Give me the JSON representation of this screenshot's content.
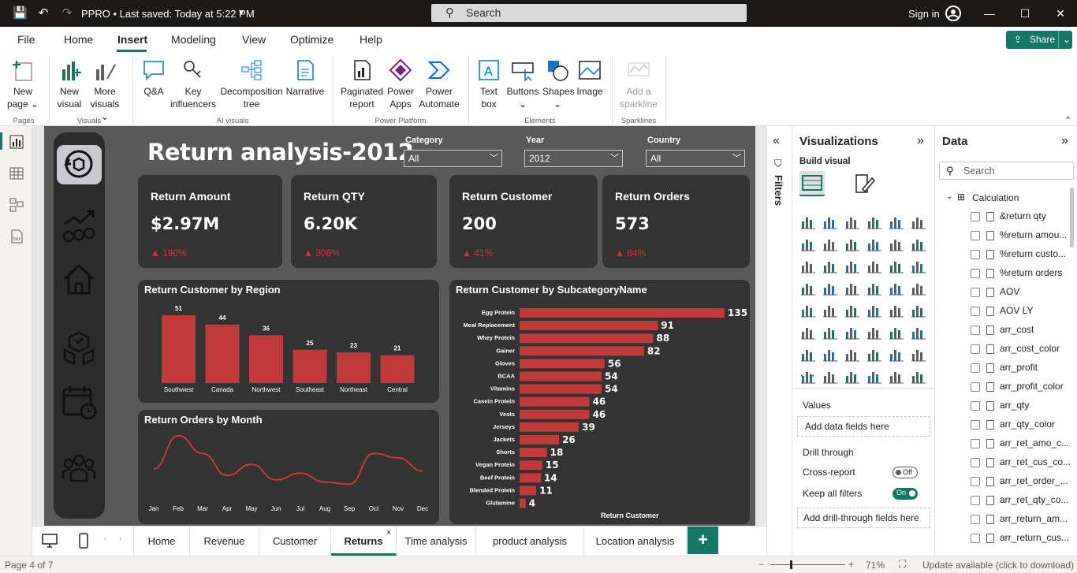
{
  "titlebar": {
    "file_title": "PPRO • Last saved: Today at 5:22 PM",
    "search_placeholder": "Search",
    "signin": "Sign in"
  },
  "menu": {
    "items": [
      "File",
      "Home",
      "Insert",
      "Modeling",
      "View",
      "Optimize",
      "Help"
    ],
    "active": "Insert",
    "share": "Share"
  },
  "ribbon": {
    "buttons": [
      {
        "l1": "New",
        "l2": "page ⌄"
      },
      {
        "l1": "New",
        "l2": "visual"
      },
      {
        "l1": "More",
        "l2": "visuals ⌄"
      },
      {
        "l1": "Q&A",
        "l2": ""
      },
      {
        "l1": "Key",
        "l2": "influencers"
      },
      {
        "l1": "Decomposition",
        "l2": "tree"
      },
      {
        "l1": "Narrative",
        "l2": ""
      },
      {
        "l1": "Paginated",
        "l2": "report"
      },
      {
        "l1": "Power",
        "l2": "Apps"
      },
      {
        "l1": "Power",
        "l2": "Automate"
      },
      {
        "l1": "Text",
        "l2": "box"
      },
      {
        "l1": "Buttons",
        "l2": "⌄"
      },
      {
        "l1": "Shapes",
        "l2": "⌄"
      },
      {
        "l1": "Image",
        "l2": ""
      },
      {
        "l1": "Add a",
        "l2": "sparkline"
      }
    ],
    "groups": [
      "Pages",
      "Visuals",
      "AI visuals",
      "Power Platform",
      "Elements",
      "Sparklines"
    ]
  },
  "report": {
    "title": "Return analysis-2012",
    "slicers": [
      {
        "label": "Category",
        "value": "All"
      },
      {
        "label": "Year",
        "value": "2012"
      },
      {
        "label": "Country",
        "value": "All"
      }
    ],
    "cards": [
      {
        "title": "Return Amount",
        "value": "$2.97M",
        "delta": "190%"
      },
      {
        "title": "Return QTY",
        "value": "6.20K",
        "delta": "308%"
      },
      {
        "title": "Return Customer",
        "value": "200",
        "delta": "41%"
      },
      {
        "title": "Return Orders",
        "value": "573",
        "delta": "84%"
      }
    ],
    "accent": "#c0393b",
    "delta_color": "#d13438"
  },
  "chart_data": [
    {
      "type": "bar",
      "title": "Return Customer by Region",
      "categories": [
        "Southwest",
        "Canada",
        "Northwest",
        "Southeast",
        "Northeast",
        "Central"
      ],
      "values": [
        51,
        44,
        36,
        25,
        23,
        21
      ]
    },
    {
      "type": "line",
      "title": "Return Orders by Month",
      "categories": [
        "Jan",
        "Feb",
        "Mar",
        "Apr",
        "May",
        "Jun",
        "Jul",
        "Aug",
        "Sep",
        "Oct",
        "Nov",
        "Dec"
      ],
      "values": [
        48,
        78,
        62,
        42,
        52,
        38,
        44,
        36,
        34,
        62,
        58,
        46
      ]
    },
    {
      "type": "bar",
      "orientation": "horizontal",
      "title": "Return Customer by SubcategoryName",
      "xlabel": "Return Customer",
      "categories": [
        "Egg Protein",
        "Meal Replacement",
        "Whey Protein",
        "Gainer",
        "Gloves",
        "BCAA",
        "Vitamins",
        "Casein Protein",
        "Vests",
        "Jerseys",
        "Jackets",
        "Shorts",
        "Vegan Protein",
        "Beef Protein",
        "Blended Protein",
        "Glutamine"
      ],
      "values": [
        135,
        91,
        88,
        82,
        56,
        54,
        54,
        46,
        46,
        39,
        26,
        18,
        15,
        14,
        11,
        4
      ]
    }
  ],
  "filters": {
    "label": "Filters"
  },
  "viz_pane": {
    "title": "Visualizations",
    "build_visual": "Build visual",
    "values": "Values",
    "add_data": "Add data fields here",
    "drill_through": "Drill through",
    "cross_report": "Cross-report",
    "cross_report_state": "Off",
    "keep_filters": "Keep all filters",
    "keep_filters_state": "On",
    "add_drill": "Add drill-through fields here"
  },
  "data_pane": {
    "title": "Data",
    "search_placeholder": "Search",
    "table": "Calculation",
    "fields": [
      "&return qty",
      "%return amou...",
      "%return custo...",
      "%return orders",
      "AOV",
      "AOV LY",
      "arr_cost",
      "arr_cost_color",
      "arr_profit",
      "arr_profit_color",
      "arr_qty",
      "arr_qty_color",
      "arr_ret_amo_c...",
      "arr_ret_cus_co...",
      "arr_ret_order_...",
      "arr_ret_qty_co...",
      "arr_return_am...",
      "arr_return_cus..."
    ]
  },
  "page_tabs": {
    "tabs": [
      "Home",
      "Revenue",
      "Customer",
      "Returns",
      "Time analysis",
      "product analysis",
      "Location analysis"
    ],
    "active": "Returns"
  },
  "status": {
    "page": "Page 4 of 7",
    "zoom": "71%",
    "update": "Update available (click to download)"
  }
}
